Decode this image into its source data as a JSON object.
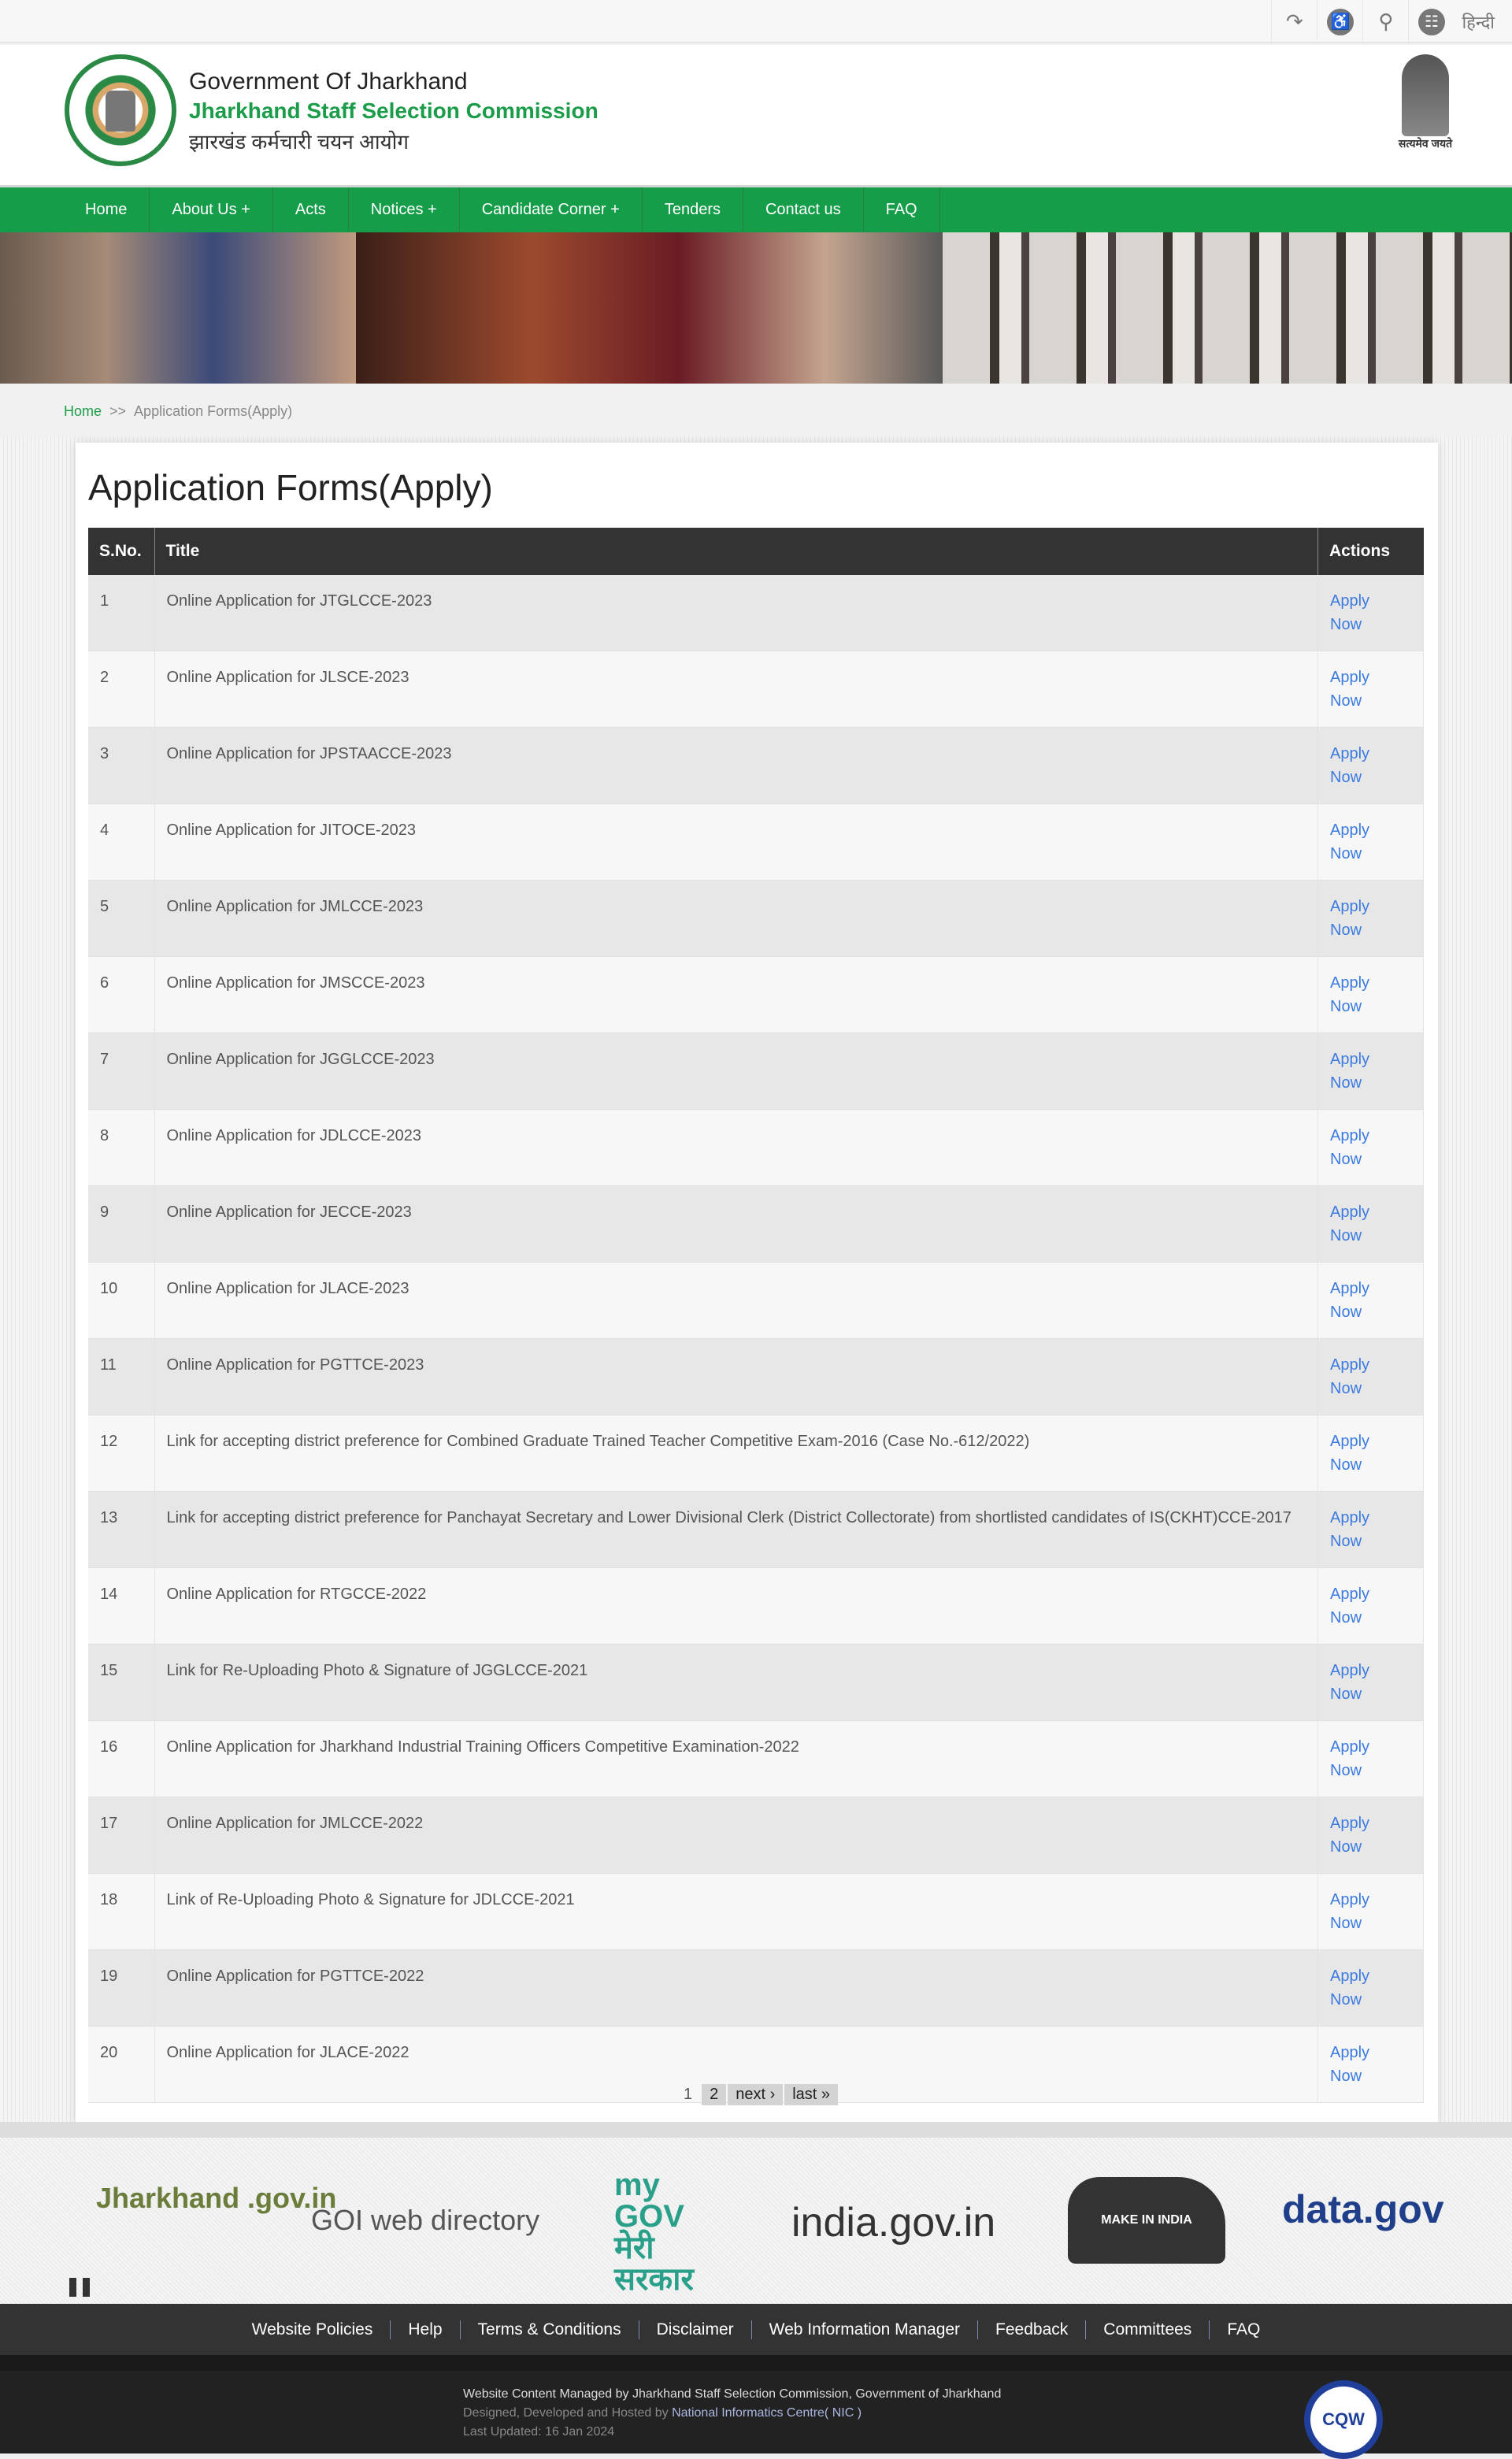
{
  "topbar": {
    "tools": [
      {
        "icon": "skip-to-content-icon"
      },
      {
        "icon": "accessibility-icon"
      },
      {
        "icon": "search-icon"
      },
      {
        "icon": "sitemap-icon"
      }
    ],
    "language": "हिन्दी"
  },
  "header": {
    "line1": "Government Of Jharkhand",
    "line2": "Jharkhand Staff Selection Commission",
    "line3": "झारखंड कर्मचारी चयन आयोग",
    "emblem_motto": "सत्यमेव जयते"
  },
  "nav": [
    "Home",
    "About Us +",
    "Acts",
    "Notices +",
    "Candidate Corner +",
    "Tenders",
    "Contact us",
    "FAQ"
  ],
  "breadcrumb": {
    "home": "Home",
    "sep": ">>",
    "current": "Application Forms(Apply)"
  },
  "page": {
    "title": "Application Forms(Apply)"
  },
  "table": {
    "headers": [
      "S.No.",
      "Title",
      "Actions"
    ],
    "action_line1": "Apply",
    "action_line2": "Now",
    "rows": [
      [
        "1",
        "Online Application for JTGLCCE-2023"
      ],
      [
        "2",
        "Online Application for JLSCE-2023"
      ],
      [
        "3",
        "Online Application for JPSTAACCE-2023"
      ],
      [
        "4",
        "Online Application for JITOCE-2023"
      ],
      [
        "5",
        "Online Application for JMLCCE-2023"
      ],
      [
        "6",
        "Online Application for JMSCCE-2023"
      ],
      [
        "7",
        "Online Application for JGGLCCE-2023"
      ],
      [
        "8",
        "Online Application for JDLCCE-2023"
      ],
      [
        "9",
        "Online Application for JECCE-2023"
      ],
      [
        "10",
        "Online Application for JLACE-2023"
      ],
      [
        "11",
        "Online Application for PGTTCE-2023"
      ],
      [
        "12",
        "Link for accepting district preference for Combined Graduate Trained Teacher Competitive Exam-2016 (Case No.-612/2022)"
      ],
      [
        "13",
        "Link for accepting district preference for Panchayat Secretary and Lower Divisional Clerk (District Collectorate) from shortlisted candidates of IS(CKHT)CCE-2017"
      ],
      [
        "14",
        "Online Application for RTGCCE-2022"
      ],
      [
        "15",
        "Link for Re-Uploading Photo & Signature of JGGLCCE-2021"
      ],
      [
        "16",
        "Online Application for Jharkhand Industrial Training Officers Competitive Examination-2022"
      ],
      [
        "17",
        "Online Application for JMLCCE-2022"
      ],
      [
        "18",
        "Link of Re-Uploading Photo & Signature for JDLCCE-2021"
      ],
      [
        "19",
        "Online Application for PGTTCE-2022"
      ],
      [
        "20",
        "Online Application for JLACE-2022"
      ]
    ]
  },
  "pager": {
    "current": "1",
    "page2": "2",
    "next": "next ›",
    "last": "last »"
  },
  "partner_logos": [
    "Jharkhand .gov.in",
    "GOI web directory",
    "my GOV मेरी सरकार",
    "india.gov.in",
    "MAKE IN INDIA",
    "data.gov"
  ],
  "footer": {
    "links": [
      "Website Policies",
      "Help",
      "Terms & Conditions",
      "Disclaimer",
      "Web Information Manager",
      "Feedback",
      "Committees",
      "FAQ"
    ],
    "managed": "Website Content Managed by Jharkhand Staff Selection Commission, Government of Jharkhand",
    "designed_prefix": "Designed, Developed and Hosted by ",
    "designed_link": "National Informatics Centre( NIC )",
    "updated": "Last Updated: 16 Jan 2024",
    "badge": "CQW"
  },
  "colors": {
    "brand_green": "#169d4a",
    "link_blue": "#3b7ae0",
    "table_header": "#333333"
  }
}
